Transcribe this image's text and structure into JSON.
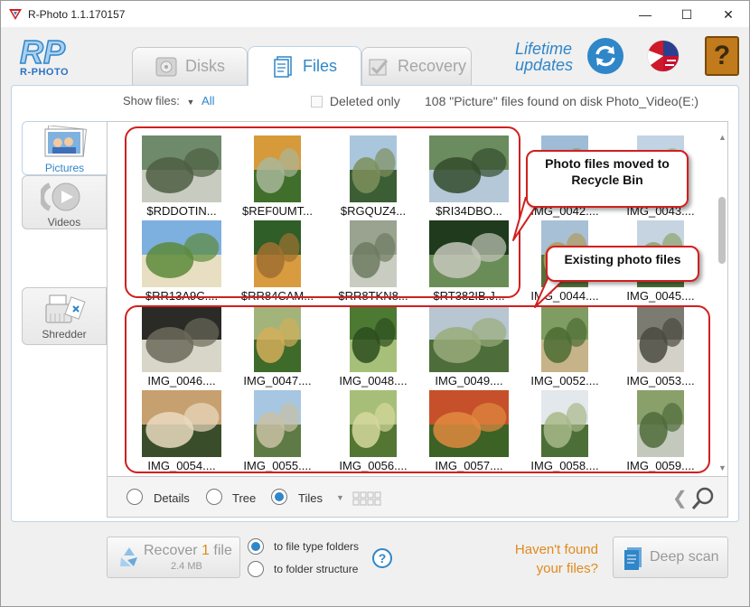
{
  "window": {
    "title": "R-Photo 1.1.170157",
    "minimize": "—",
    "maximize": "☐",
    "close": "✕"
  },
  "logo": {
    "text": "R-PHOTO"
  },
  "tabs": [
    {
      "label": "Disks",
      "active": false
    },
    {
      "label": "Files",
      "active": true
    },
    {
      "label": "Recovery",
      "active": false
    }
  ],
  "header": {
    "lifetime_line1": "Lifetime",
    "lifetime_line2": "updates",
    "help_label": "?"
  },
  "filter": {
    "show_label": "Show files:",
    "show_value": "All",
    "deleted_only_label": "Deleted only",
    "found_text": "108 \"Picture\" files found on disk Photo_Video(E:)"
  },
  "side_tabs": [
    {
      "label": "Pictures",
      "active": true
    },
    {
      "label": "Videos",
      "active": false
    },
    {
      "label": "Shredder",
      "active": false
    }
  ],
  "files": [
    {
      "name": "$RDDOTIN...",
      "colors": [
        "#6f8a6a",
        "#c8cbc0",
        "#4d5e42"
      ]
    },
    {
      "name": "$REF0UMT...",
      "colors": [
        "#d69a3a",
        "#3f6f2b",
        "#a9b79a"
      ]
    },
    {
      "name": "$RGQUZ4...",
      "colors": [
        "#a9c6dc",
        "#3c5e35",
        "#7e8f5c"
      ]
    },
    {
      "name": "$RI34DBO...",
      "colors": [
        "#6b8c5e",
        "#b5c8d8",
        "#324b2c"
      ]
    },
    {
      "name": "IMG_0042....",
      "colors": [
        "#9fbcd7",
        "#4f6f3d",
        "#8aa06a"
      ]
    },
    {
      "name": "IMG_0043....",
      "colors": [
        "#c2d4e4",
        "#5c7a40",
        "#a3b27e"
      ]
    },
    {
      "name": "$RR13A9C....",
      "colors": [
        "#7db0df",
        "#e8dfc3",
        "#5c8a3a"
      ]
    },
    {
      "name": "$RR84CAM...",
      "colors": [
        "#2f5e28",
        "#d89b40",
        "#a07030"
      ]
    },
    {
      "name": "$RR8TKN8...",
      "colors": [
        "#9aa290",
        "#c9ccc0",
        "#6d7a60"
      ]
    },
    {
      "name": "$RT382IB.J...",
      "colors": [
        "#1f3a1c",
        "#6a8d58",
        "#c5c8bb"
      ]
    },
    {
      "name": "IMG_0044....",
      "colors": [
        "#a8c0d5",
        "#57703a",
        "#b19b5d"
      ]
    },
    {
      "name": "IMG_0045....",
      "colors": [
        "#c5d4e0",
        "#4c6e38",
        "#8ea46c"
      ]
    },
    {
      "name": "IMG_0046....",
      "colors": [
        "#2a2a26",
        "#d8d6c8",
        "#6b6a5a"
      ]
    },
    {
      "name": "IMG_0047....",
      "colors": [
        "#a2b47a",
        "#3e6a2a",
        "#d3ae5a"
      ]
    },
    {
      "name": "IMG_0048....",
      "colors": [
        "#4d7a33",
        "#a6c07a",
        "#2c4d1d"
      ]
    },
    {
      "name": "IMG_0049....",
      "colors": [
        "#b7c6d1",
        "#4d6d3b",
        "#99ac7a"
      ]
    },
    {
      "name": "IMG_0052....",
      "colors": [
        "#7f9d62",
        "#c6b389",
        "#4b6b34"
      ]
    },
    {
      "name": "IMG_0053....",
      "colors": [
        "#7b7b72",
        "#d4d2c8",
        "#4a4a40"
      ]
    },
    {
      "name": "IMG_0054....",
      "colors": [
        "#c7a070",
        "#3a4d2b",
        "#eadac0"
      ]
    },
    {
      "name": "IMG_0055....",
      "colors": [
        "#a6c6e2",
        "#5e7a45",
        "#c9c1a4"
      ]
    },
    {
      "name": "IMG_0056....",
      "colors": [
        "#a7be78",
        "#537632",
        "#d6d89d"
      ]
    },
    {
      "name": "IMG_0057....",
      "colors": [
        "#c6502a",
        "#3c6226",
        "#e08a40"
      ]
    },
    {
      "name": "IMG_0058....",
      "colors": [
        "#e3e8ec",
        "#4c6f37",
        "#a8b888"
      ]
    },
    {
      "name": "IMG_0059....",
      "colors": [
        "#8aa06b",
        "#c3c9bd",
        "#4f6b3a"
      ]
    }
  ],
  "callouts": {
    "deleted": "Photo files moved to Recycle Bin",
    "existing": "Existing photo files"
  },
  "view": {
    "details": "Details",
    "tree": "Tree",
    "tiles": "Tiles",
    "selected": "Tiles"
  },
  "bottom": {
    "recover_prefix": "Recover ",
    "recover_count": "1",
    "recover_suffix": " file",
    "recover_size": "2.4 MB",
    "option_type_folders": "to file type folders",
    "option_folder_structure": "to folder structure",
    "help_label": "?",
    "havent_found_line1": "Haven't found",
    "havent_found_line2": "your files?",
    "deep_scan": "Deep scan"
  },
  "colors": {
    "accent": "#2f86c8",
    "callout": "#d11f1f",
    "orange": "#e08a1c"
  }
}
